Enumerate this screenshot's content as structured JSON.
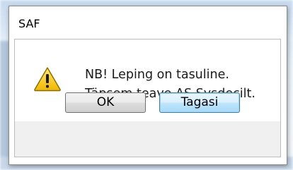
{
  "dialog": {
    "title": "SAF",
    "message_lines": [
      "NB! Leping on tasuline.",
      "Täpsem teave AS Sysdecilt."
    ],
    "icon": "warning-icon",
    "buttons": {
      "ok_label": "OK",
      "cancel_label": "Tagasi"
    }
  },
  "colors": {
    "warning_fill": "#f5c400",
    "warning_stroke": "#8a6a00",
    "focused_button_border": "#3c7fb1"
  }
}
